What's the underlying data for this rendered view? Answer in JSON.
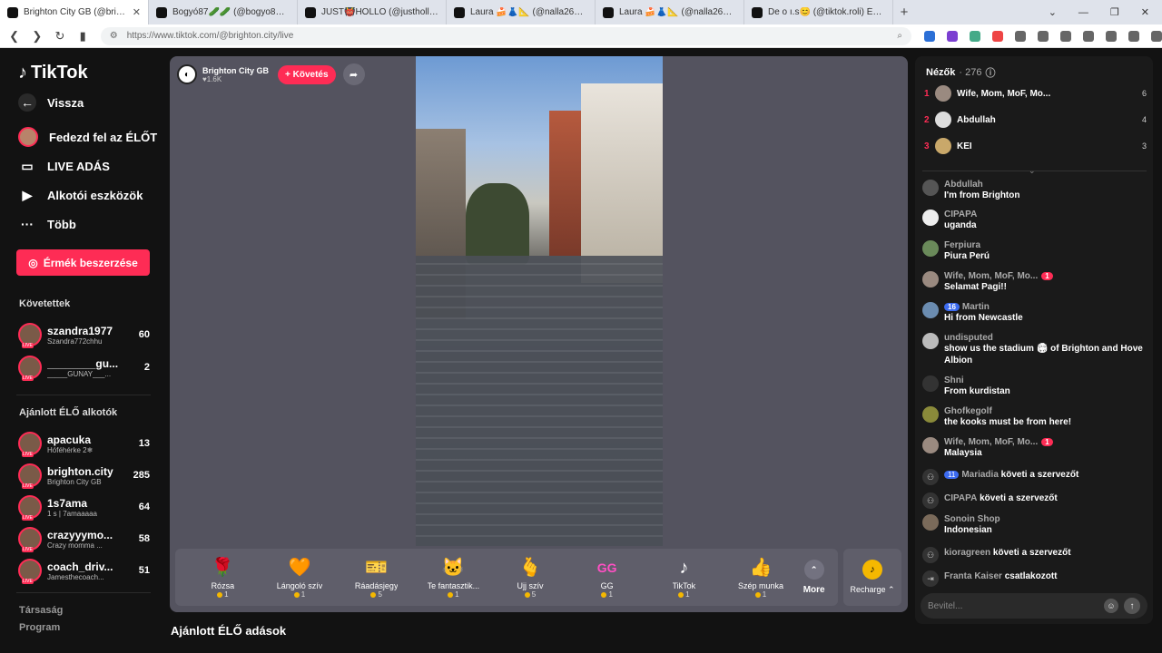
{
  "browser": {
    "tabs": [
      {
        "title": "Brighton City GB (@brightoncity)",
        "active": true
      },
      {
        "title": "Bogyó87🥒🥒 (@bogyo87__) ÉLŐ adás",
        "active": false
      },
      {
        "title": "JUST👹HOLLO (@justholloadam) ÉLŐ",
        "active": false
      },
      {
        "title": "Laura 🍰👗📐 (@nalla2635) ÉLŐ adás",
        "active": false
      },
      {
        "title": "Laura 🍰👗📐 (@nalla2635) ÉLŐ adás",
        "active": false
      },
      {
        "title": "De o ı.s😊 (@tiktok.roli) ÉLŐ adás",
        "active": false
      }
    ],
    "url": "https://www.tiktok.com/@brighton.city/live"
  },
  "sidebar": {
    "logo": "TikTok",
    "back": "Vissza",
    "explore": "Fedezd fel az ÉLŐT",
    "live": "LIVE ADÁS",
    "creator": "Alkotói eszközök",
    "more": "Több",
    "coins": "Érmék beszerzése",
    "following_title": "Követettek",
    "following": [
      {
        "name": "szandra1977",
        "sub": "Szandra772chhu",
        "count": "60"
      },
      {
        "name": "________gu...",
        "sub": "_____GUNAY___...",
        "count": "2"
      }
    ],
    "recommended_title": "Ajánlott ÉLŐ alkotók",
    "recommended": [
      {
        "name": "apacuka",
        "sub": "Hóféhérke 2❄",
        "count": "13"
      },
      {
        "name": "brighton.city",
        "sub": "Brighton City GB",
        "count": "285"
      },
      {
        "name": "1s7ama",
        "sub": "1 s | 7amaaaaa",
        "count": "64"
      },
      {
        "name": "crazyyymo...",
        "sub": "Crazy momma ...",
        "count": "58"
      },
      {
        "name": "coach_driv...",
        "sub": "Jamesthecoach...",
        "count": "51"
      }
    ],
    "footer": [
      "Társaság",
      "Program"
    ]
  },
  "player": {
    "host_name": "Brighton City GB",
    "likes": "♥1.6K",
    "follow": "+ Követés",
    "gifts": [
      {
        "name": "Rózsa",
        "price": "1",
        "icon": "🌹"
      },
      {
        "name": "Lángoló szív",
        "price": "1",
        "icon": "🧡"
      },
      {
        "name": "Ráadásjegy",
        "price": "5",
        "icon": "🎫"
      },
      {
        "name": "Te fantasztik...",
        "price": "1",
        "icon": "🐱"
      },
      {
        "name": "Ujj szív",
        "price": "5",
        "icon": "🫰"
      },
      {
        "name": "GG",
        "price": "1",
        "icon": "GG"
      },
      {
        "name": "TikTok",
        "price": "1",
        "icon": "♪"
      },
      {
        "name": "Szép munka",
        "price": "1",
        "icon": "👍"
      }
    ],
    "more": "More",
    "recharge": "Recharge ⌃"
  },
  "recommended_live_title": "Ajánlott ÉLŐ adások",
  "viewers": {
    "title": "Nézők",
    "count": "· 276",
    "top": [
      {
        "rank": "1",
        "name": "Wife, Mom, MoF, Mo...",
        "score": "6"
      },
      {
        "rank": "2",
        "name": "Abdullah",
        "score": "4"
      },
      {
        "rank": "3",
        "name": "KEI",
        "score": "3"
      }
    ]
  },
  "chat": [
    {
      "user": "Abdullah",
      "text": "I'm from Brighton",
      "badge": "",
      "sys": false
    },
    {
      "user": "CIPAPA",
      "text": "uganda",
      "badge": "",
      "sys": false
    },
    {
      "user": "Ferpiura",
      "text": "Piura Perú",
      "badge": "",
      "sys": false
    },
    {
      "user": "Wife, Mom, MoF, Mo...",
      "text": "Selamat Pagi!!",
      "badge": "1",
      "sys": false
    },
    {
      "user": "Martin",
      "text": "Hi from Newcastle",
      "badge": "16",
      "sys": false
    },
    {
      "user": "undisputed",
      "text": "show us the stadium 🏟 of Brighton and Hove Albion",
      "badge": "",
      "sys": false
    },
    {
      "user": "Shni",
      "text": "From kurdistan",
      "badge": "",
      "sys": false
    },
    {
      "user": "Ghofkegolf",
      "text": "the kooks must be from here!",
      "badge": "",
      "sys": false
    },
    {
      "user": "Wife, Mom, MoF, Mo...",
      "text": "Malaysia",
      "badge": "1",
      "sys": false
    },
    {
      "user": "Mariadia",
      "text": "követi a szervezőt",
      "badge": "11",
      "sys": true
    },
    {
      "user": "CIPAPA",
      "text": "követi a szervezőt",
      "badge": "",
      "sys": true
    },
    {
      "user": "Sonoin Shop",
      "text": "Indonesian",
      "badge": "",
      "sys": false
    },
    {
      "user": "kioragreen",
      "text": "követi a szervezőt",
      "badge": "",
      "sys": true
    },
    {
      "user": "Franta Kaiser",
      "text": "csatlakozott",
      "badge": "",
      "sys": true
    }
  ],
  "input_placeholder": "Bevitel..."
}
